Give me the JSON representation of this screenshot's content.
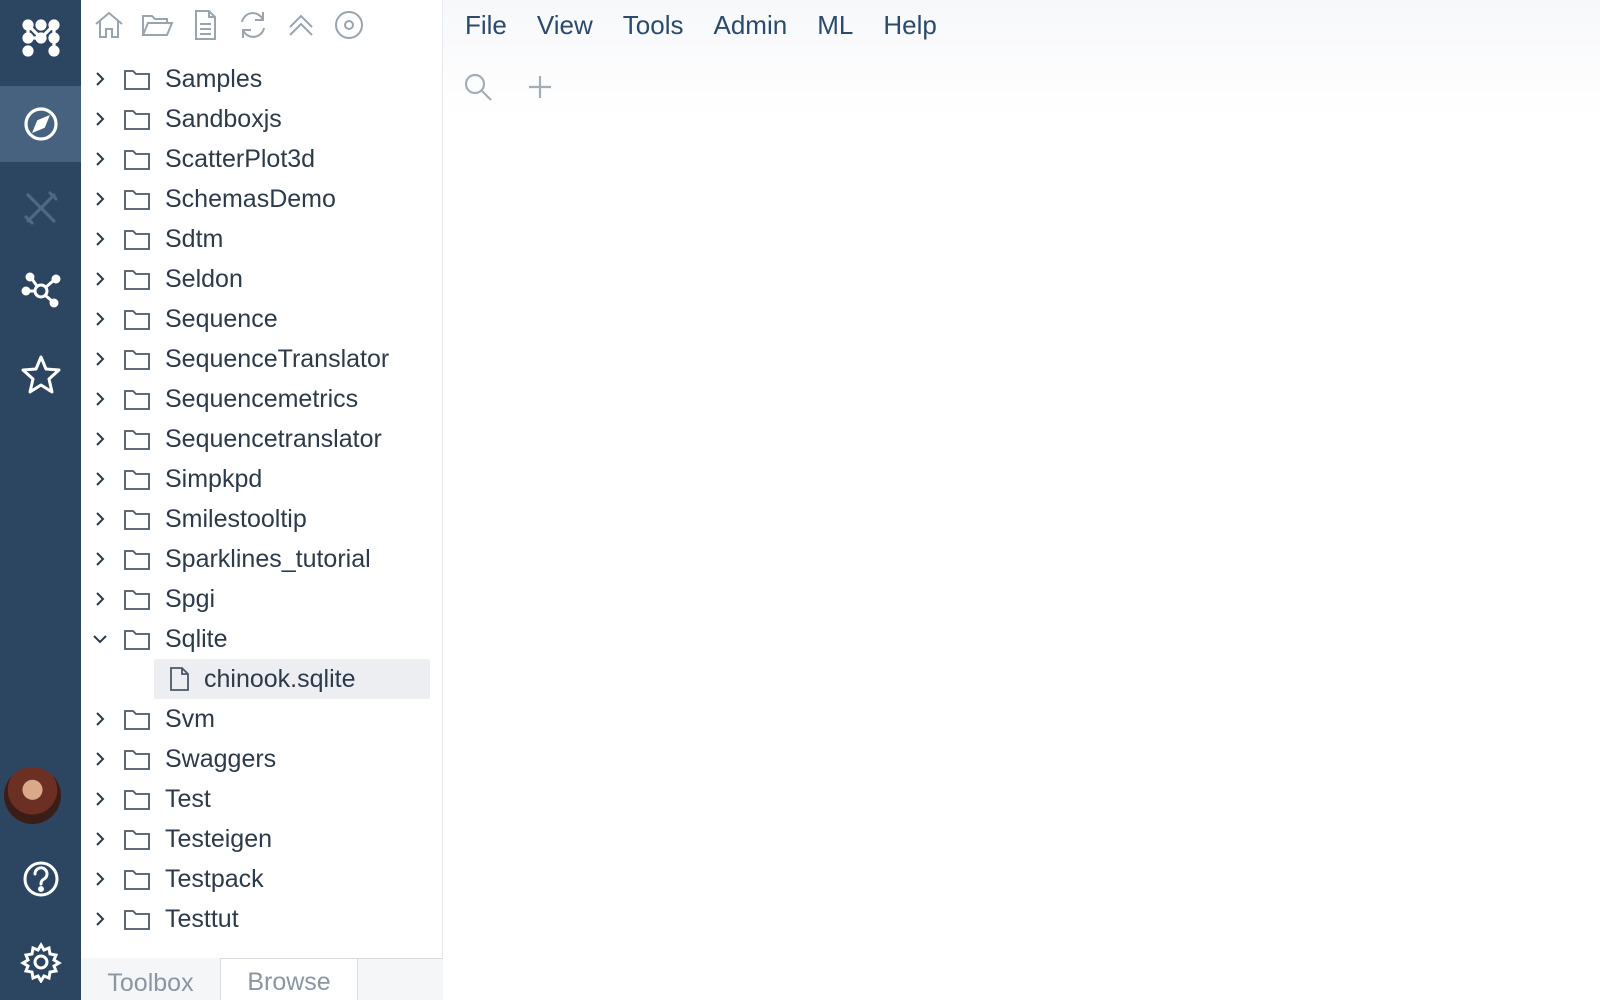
{
  "rail": {
    "items": [
      {
        "name": "logo-icon"
      },
      {
        "name": "compass-icon",
        "active": true
      },
      {
        "name": "scripts-icon"
      },
      {
        "name": "network-icon"
      },
      {
        "name": "star-icon"
      },
      {
        "name": "avatar"
      },
      {
        "name": "help-icon"
      },
      {
        "name": "gear-icon"
      }
    ]
  },
  "panel": {
    "toolbar": [
      "home-icon",
      "open-folder-icon",
      "file-icon",
      "refresh-icon",
      "collapse-up-icon",
      "target-icon"
    ],
    "tree": [
      {
        "label": "Samples",
        "expanded": false
      },
      {
        "label": "Sandboxjs",
        "expanded": false
      },
      {
        "label": "ScatterPlot3d",
        "expanded": false
      },
      {
        "label": "SchemasDemo",
        "expanded": false
      },
      {
        "label": "Sdtm",
        "expanded": false
      },
      {
        "label": "Seldon",
        "expanded": false
      },
      {
        "label": "Sequence",
        "expanded": false
      },
      {
        "label": "SequenceTranslator",
        "expanded": false
      },
      {
        "label": "Sequencemetrics",
        "expanded": false
      },
      {
        "label": "Sequencetranslator",
        "expanded": false
      },
      {
        "label": "Simpkpd",
        "expanded": false
      },
      {
        "label": "Smilestooltip",
        "expanded": false
      },
      {
        "label": "Sparklines_tutorial",
        "expanded": false
      },
      {
        "label": "Spgi",
        "expanded": false
      },
      {
        "label": "Sqlite",
        "expanded": true,
        "children": [
          {
            "label": "chinook.sqlite"
          }
        ]
      },
      {
        "label": "Svm",
        "expanded": false
      },
      {
        "label": "Swaggers",
        "expanded": false
      },
      {
        "label": "Test",
        "expanded": false
      },
      {
        "label": "Testeigen",
        "expanded": false
      },
      {
        "label": "Testpack",
        "expanded": false
      },
      {
        "label": "Testtut",
        "expanded": false
      }
    ],
    "tabs": {
      "toolbox": "Toolbox",
      "browse": "Browse"
    }
  },
  "menu": [
    "File",
    "View",
    "Tools",
    "Admin",
    "ML",
    "Help"
  ],
  "colors": {
    "rail": "#2c4560",
    "rail_active": "#46627f",
    "menu_text": "#2c4a6b",
    "selected_row": "#eceef2"
  }
}
